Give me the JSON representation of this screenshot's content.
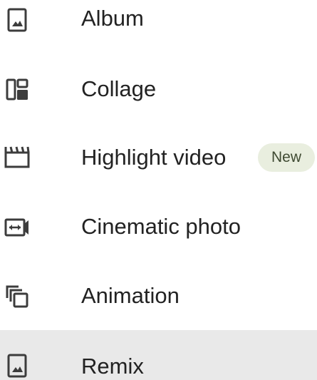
{
  "menu": {
    "items": [
      {
        "label": "Album",
        "icon": "album-icon"
      },
      {
        "label": "Collage",
        "icon": "collage-icon"
      },
      {
        "label": "Highlight video",
        "icon": "highlight-video-icon",
        "badge": "New"
      },
      {
        "label": "Cinematic photo",
        "icon": "cinematic-photo-icon"
      },
      {
        "label": "Animation",
        "icon": "animation-icon"
      },
      {
        "label": "Remix",
        "icon": "remix-icon",
        "highlighted": true
      }
    ]
  },
  "colors": {
    "text": "#222222",
    "icon": "#3c3c3c",
    "highlight_background": "#e9e9e9",
    "badge_background": "#e9eedf",
    "badge_text": "#3f4a32"
  }
}
